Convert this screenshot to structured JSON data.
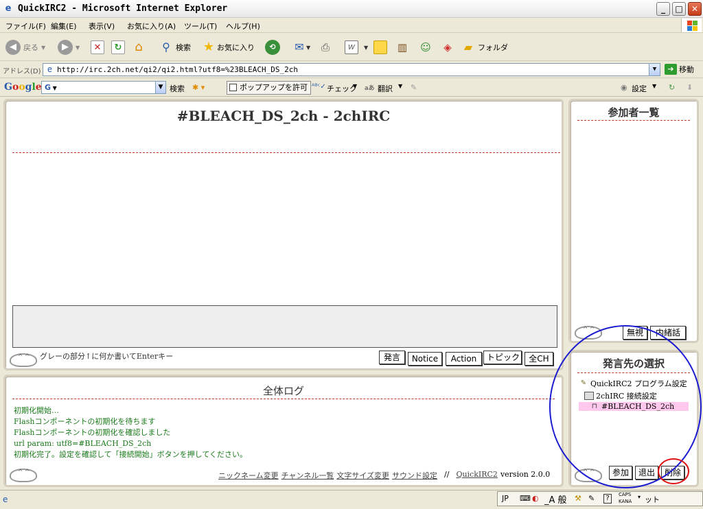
{
  "window": {
    "title": "QuickIRC2 - Microsoft Internet Explorer",
    "min": "_",
    "max": "□",
    "close": "✕"
  },
  "menu": {
    "items": [
      "ファイル(F)",
      "編集(E)",
      "表示(V)",
      "お気に入り(A)",
      "ツール(T)",
      "ヘルプ(H)"
    ]
  },
  "toolbar": {
    "back": "戻る",
    "search": "検索",
    "favorites": "お気に入り",
    "folder": "フォルダ"
  },
  "address": {
    "label": "アドレス(D)",
    "url": "http://irc.2ch.net/qi2/qi2.html?utf8=%23BLEACH_DS_2ch",
    "go": "移動"
  },
  "google": {
    "logo": "Google",
    "box": "G",
    "search": "検索",
    "popup": "ポップアップを許可",
    "check": "チェック",
    "translate": "翻訳",
    "settings": "設定"
  },
  "chat": {
    "title": "#BLEACH_DS_2ch - 2chIRC",
    "hint": "グレーの部分↑に何か書いてEnterキー",
    "buttons": [
      "発言",
      "Notice",
      "Action",
      "トピック",
      "全CH"
    ]
  },
  "participants": {
    "title": "参加者一覧",
    "ignore": "無視",
    "whisper": "内緒話"
  },
  "log": {
    "title": "全体ログ",
    "lines": [
      "初期化開始…",
      "Flashコンポーネントの初期化を待ちます",
      "Flashコンポーネントの初期化を確認しました",
      "url param: utf8=#BLEACH_DS_2ch",
      "初期化完了。設定を確認して「接続開始」ボタンを押してください。"
    ],
    "links": [
      "ニックネーム変更",
      "チャンネル一覧",
      "文字サイズ変更",
      "サウンド設定"
    ],
    "separator": "//",
    "app_link": "QuickIRC2",
    "version": "version 2.0.0"
  },
  "target": {
    "title": "発言先の選択",
    "items": [
      "QuickIRC2 プログラム設定",
      "2chIRC 接続設定",
      "#BLEACH_DS_2ch"
    ],
    "join": "参加",
    "leave": "退出",
    "delete": "削除"
  },
  "status": {
    "lang": "JP",
    "mode": "_A 般",
    "caps": "CAPS",
    "kana": "KANA",
    "tail": "ット"
  },
  "colors": {
    "selected_item_bg": "#ffc8ec",
    "log_text": "#1a7a1a",
    "annotation_blue": "#1b1bd0",
    "annotation_red": "#e01010"
  }
}
